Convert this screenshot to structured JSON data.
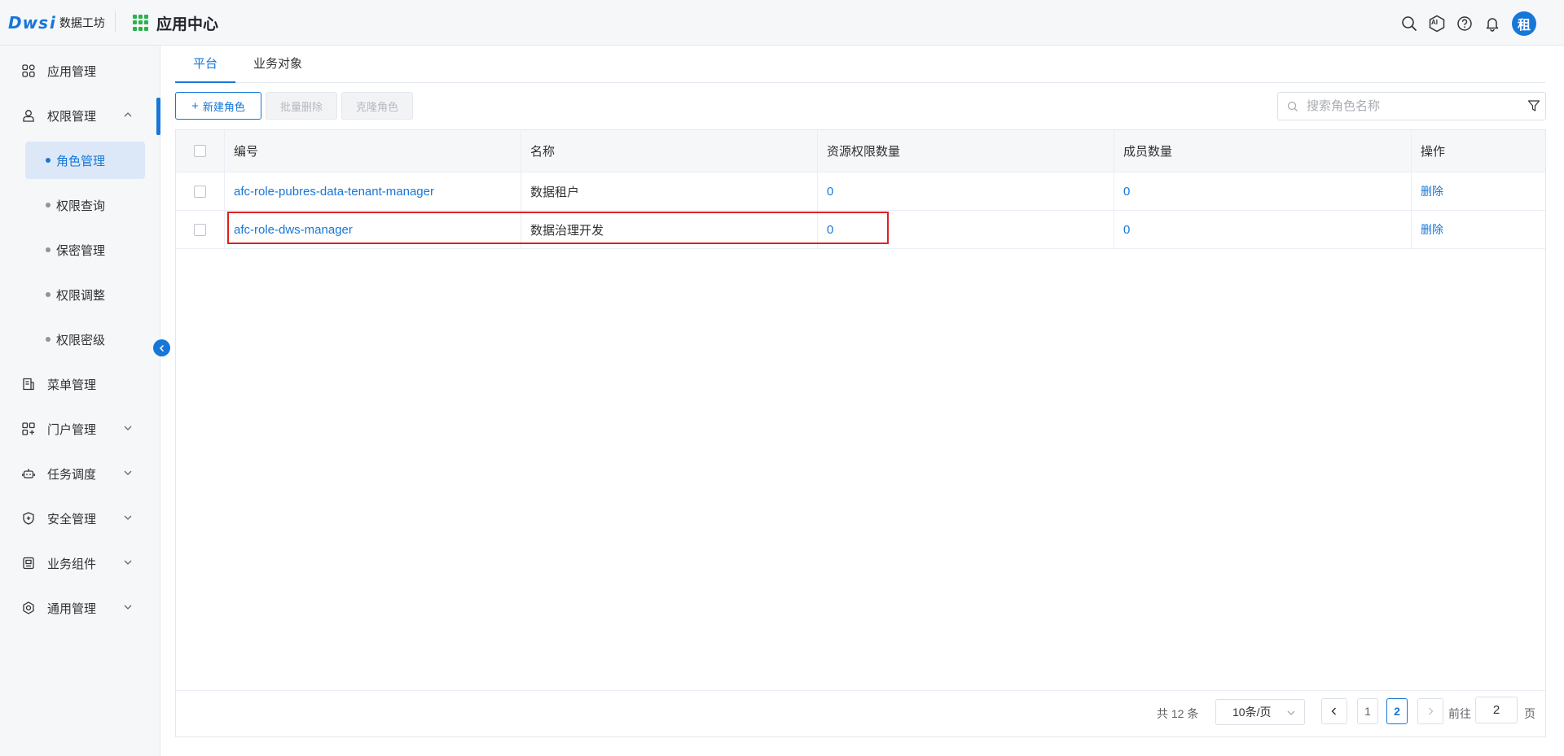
{
  "header": {
    "logo_text": "Dws",
    "logo_i": "i",
    "logo_sub": "数据工坊",
    "app_title": "应用中心",
    "avatar_text": "租",
    "ai_label": "AI"
  },
  "sidebar": {
    "items": [
      {
        "label": "应用管理",
        "icon": "apps-icon"
      },
      {
        "label": "权限管理",
        "icon": "user-icon",
        "expanded": true
      },
      {
        "label": "菜单管理",
        "icon": "menu-doc-icon"
      },
      {
        "label": "门户管理",
        "icon": "portal-icon"
      },
      {
        "label": "任务调度",
        "icon": "robot-icon"
      },
      {
        "label": "安全管理",
        "icon": "shield-icon"
      },
      {
        "label": "业务组件",
        "icon": "component-icon"
      },
      {
        "label": "通用管理",
        "icon": "settings-icon"
      }
    ],
    "sub_items": [
      {
        "label": "角色管理",
        "active": true
      },
      {
        "label": "权限查询"
      },
      {
        "label": "保密管理"
      },
      {
        "label": "权限调整"
      },
      {
        "label": "权限密级"
      }
    ]
  },
  "tabs": [
    {
      "label": "平台",
      "active": true
    },
    {
      "label": "业务对象"
    }
  ],
  "toolbar": {
    "new_role": "新建角色",
    "batch_delete": "批量删除",
    "clone_role": "克隆角色",
    "search_placeholder": "搜索角色名称"
  },
  "table": {
    "columns": [
      "编号",
      "名称",
      "资源权限数量",
      "成员数量",
      "操作"
    ],
    "rows": [
      {
        "code": "afc-role-pubres-data-tenant-manager",
        "name": "数据租户",
        "resource_count": "0",
        "member_count": "0",
        "action": "删除"
      },
      {
        "code": "afc-role-dws-manager",
        "name": "数据治理开发",
        "resource_count": "0",
        "member_count": "0",
        "action": "删除"
      }
    ]
  },
  "pagination": {
    "total": "共 12 条",
    "page_size": "10条/页",
    "pages": [
      "1",
      "2"
    ],
    "current_page": "2",
    "goto_label": "前往",
    "goto_value": "2",
    "goto_unit": "页"
  },
  "colors": {
    "accent": "#1677d8",
    "highlight": "#e02020"
  }
}
